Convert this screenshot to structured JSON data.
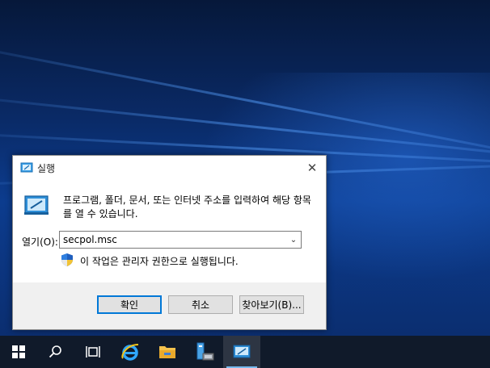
{
  "dialog": {
    "title": "실행",
    "description": "프로그램, 폴더, 문서, 또는 인터넷 주소를 입력하여 해당 항목를 열 수 있습니다.",
    "open_label": "열기(O):",
    "input_value": "secpol.msc",
    "admin_note": "이 작업은 관리자 권한으로 실행됩니다.",
    "ok_label": "확인",
    "cancel_label": "취소",
    "browse_label": "찾아보기(B)..."
  },
  "taskbar": {
    "items": [
      "start-icon",
      "search-icon",
      "task-view-icon",
      "internet-explorer-icon",
      "file-explorer-icon",
      "server-manager-icon",
      "run-icon"
    ]
  },
  "colors": {
    "accent": "#0078d7",
    "taskbar": "#101a2a",
    "button_bar": "#f0f0f0"
  }
}
